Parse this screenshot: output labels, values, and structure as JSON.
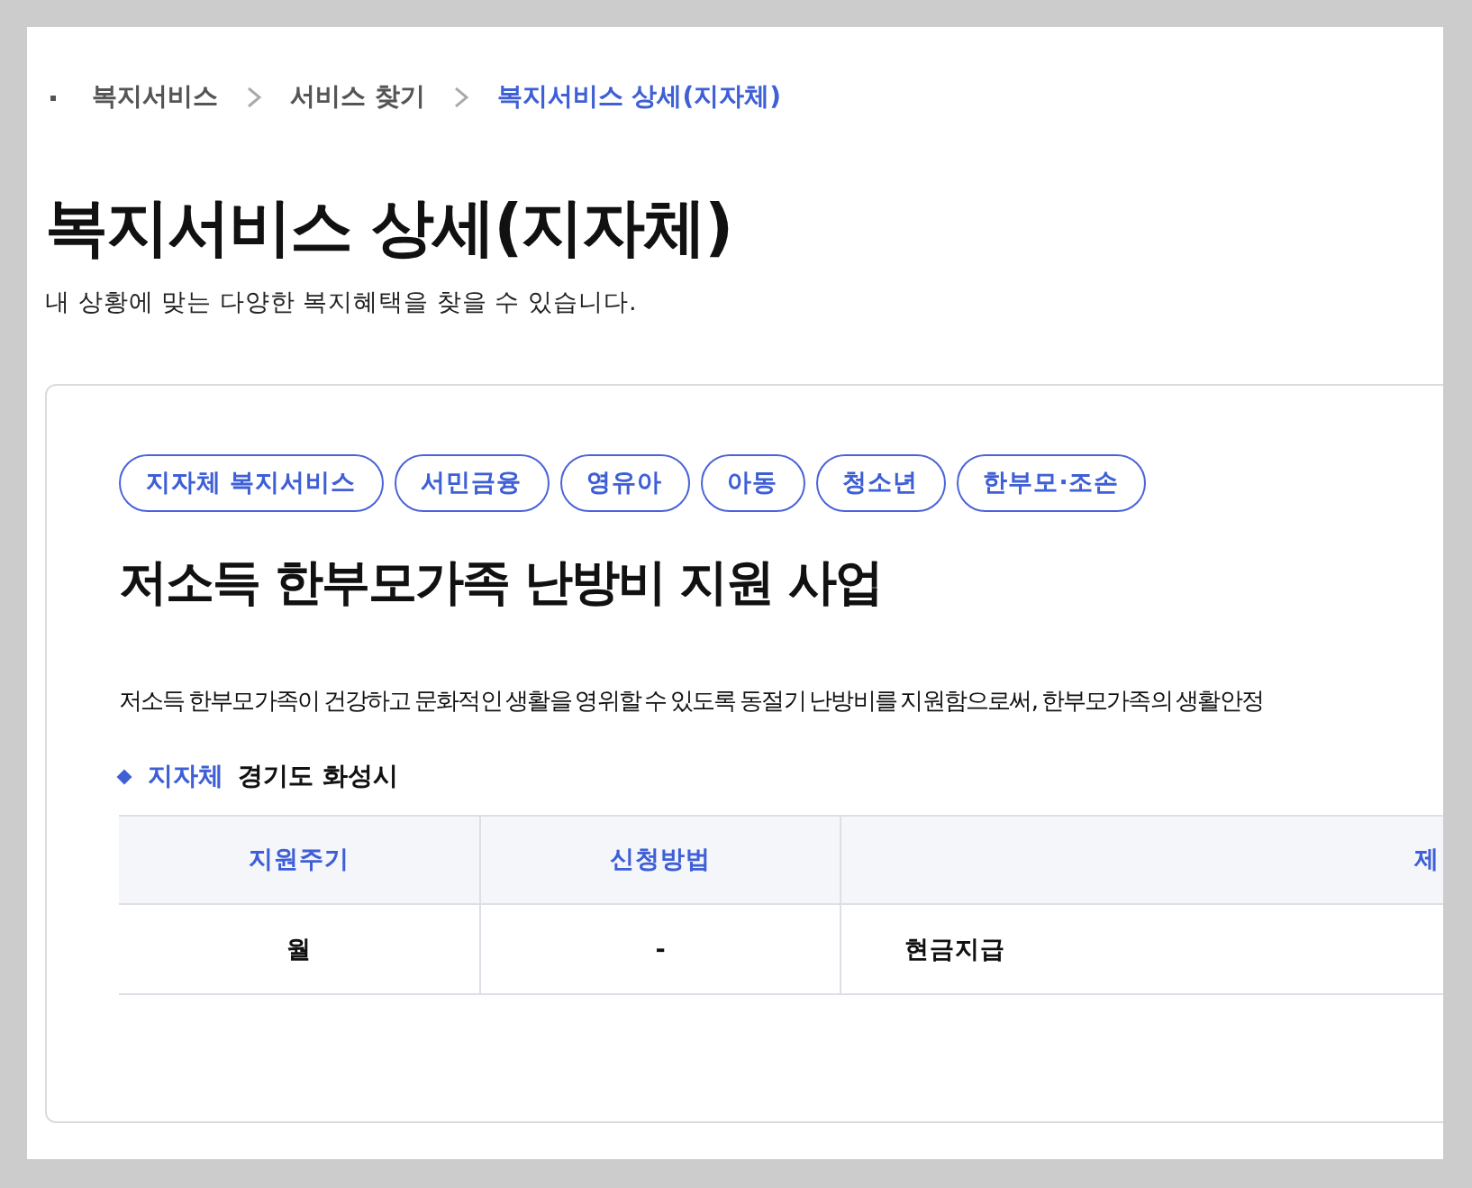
{
  "breadcrumb": [
    {
      "label": "복지서비스",
      "selected": false
    },
    {
      "label": "서비스 찾기",
      "selected": false
    },
    {
      "label": "복지서비스 상세(지자체)",
      "selected": true
    }
  ],
  "page_title": "복지서비스 상세(지자체)",
  "page_subtitle": "내 상황에 맞는 다양한 복지혜택을 찾을 수 있습니다.",
  "service": {
    "tags": [
      "지자체 복지서비스",
      "서민금융",
      "영유아",
      "아동",
      "청소년",
      "한부모·조손"
    ],
    "title": "저소득 한부모가족 난방비 지원 사업",
    "description": "저소득 한부모가족이 건강하고 문화적인 생활을 영위할 수 있도록 동절기 난방비를 지원함으로써, 한부모가족의 생활안정",
    "agency_label": "지자체",
    "agency_value": "경기도 화성시",
    "table": {
      "columns": [
        "지원주기",
        "신청방법",
        "제"
      ],
      "rows": [
        [
          "월",
          "-",
          "현금지급"
        ]
      ]
    }
  }
}
